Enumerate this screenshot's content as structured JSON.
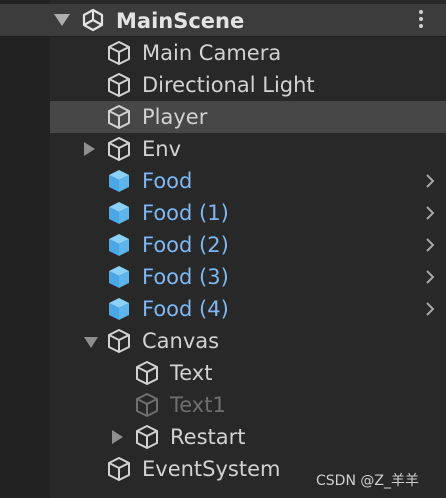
{
  "scene": {
    "title": "MainScene",
    "icon": "unity-logo-icon",
    "menu_icon": "vertical-ellipsis-icon"
  },
  "colors": {
    "background": "#282828",
    "header": "#3c3c3c",
    "selected_row": "#474747",
    "text": "#d2d2d2",
    "prefab_text": "#7cb9f4",
    "prefab_icon": "#5db6ee",
    "inactive_text": "#6f6f6f"
  },
  "hierarchy": [
    {
      "label": "Main Camera",
      "depth": 0,
      "icon": "gameobject-cube-icon"
    },
    {
      "label": "Directional Light",
      "depth": 0,
      "icon": "gameobject-cube-icon"
    },
    {
      "label": "Player",
      "depth": 0,
      "icon": "gameobject-cube-icon",
      "selected": true
    },
    {
      "label": "Env",
      "depth": 0,
      "icon": "gameobject-cube-icon",
      "expandable": true,
      "expanded": false
    },
    {
      "label": "Food",
      "depth": 0,
      "icon": "prefab-cube-icon",
      "prefab": true
    },
    {
      "label": "Food (1)",
      "depth": 0,
      "icon": "prefab-cube-icon",
      "prefab": true
    },
    {
      "label": "Food (2)",
      "depth": 0,
      "icon": "prefab-cube-icon",
      "prefab": true
    },
    {
      "label": "Food (3)",
      "depth": 0,
      "icon": "prefab-cube-icon",
      "prefab": true
    },
    {
      "label": "Food (4)",
      "depth": 0,
      "icon": "prefab-cube-icon",
      "prefab": true
    },
    {
      "label": "Canvas",
      "depth": 0,
      "icon": "gameobject-cube-icon",
      "expandable": true,
      "expanded": true
    },
    {
      "label": "Text",
      "depth": 1,
      "icon": "gameobject-cube-icon"
    },
    {
      "label": "Text1",
      "depth": 1,
      "icon": "gameobject-cube-icon",
      "inactive": true
    },
    {
      "label": "Restart",
      "depth": 1,
      "icon": "gameobject-cube-icon",
      "expandable": true,
      "expanded": false
    },
    {
      "label": "EventSystem",
      "depth": 0,
      "icon": "gameobject-cube-icon"
    }
  ],
  "watermark": "CSDN @Z_羊羊"
}
